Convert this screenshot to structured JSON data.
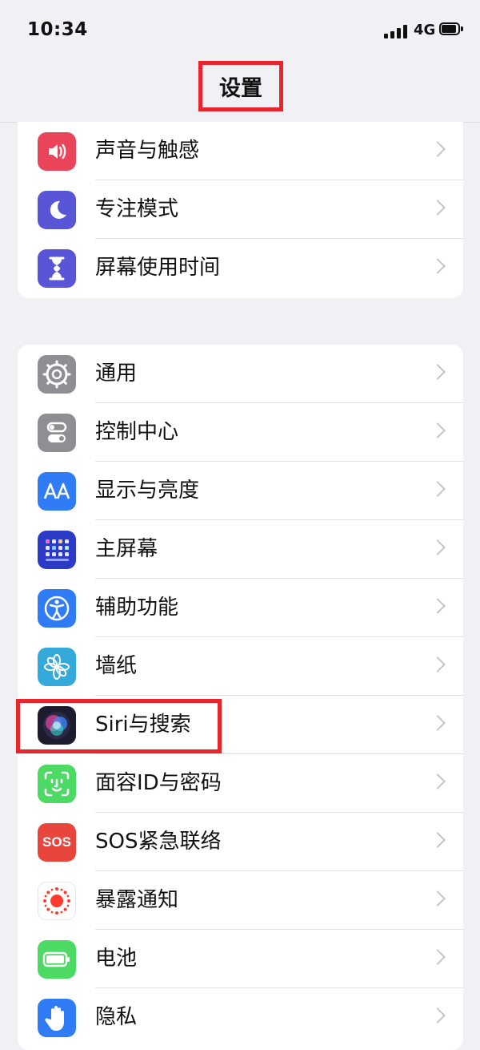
{
  "status_bar": {
    "time": "10:34",
    "network": "4G"
  },
  "nav": {
    "title": "设置"
  },
  "groups": [
    {
      "items": [
        {
          "label": "声音与触感",
          "icon": "speaker-icon",
          "color": "#e9445a"
        },
        {
          "label": "专注模式",
          "icon": "moon-icon",
          "color": "#5856d6"
        },
        {
          "label": "屏幕使用时间",
          "icon": "hourglass-icon",
          "color": "#5856d6"
        }
      ]
    },
    {
      "items": [
        {
          "label": "通用",
          "icon": "gear-icon",
          "color": "#8e8e93"
        },
        {
          "label": "控制中心",
          "icon": "toggles-icon",
          "color": "#8e8e93"
        },
        {
          "label": "显示与亮度",
          "icon": "text-size-icon",
          "color": "#2f7cf6"
        },
        {
          "label": "主屏幕",
          "icon": "home-grid-icon",
          "color": "#2b3bc6"
        },
        {
          "label": "辅助功能",
          "icon": "accessibility-icon",
          "color": "#2f7cf6"
        },
        {
          "label": "墙纸",
          "icon": "flower-icon",
          "color": "#34aadc"
        },
        {
          "label": "Siri与搜索",
          "icon": "siri-icon",
          "color": "#1c1c2e"
        },
        {
          "label": "面容ID与密码",
          "icon": "face-id-icon",
          "color": "#4cd964"
        },
        {
          "label": "SOS紧急联络",
          "icon": "sos-icon",
          "color": "#e8453c",
          "icon_text": "SOS"
        },
        {
          "label": "暴露通知",
          "icon": "exposure-icon",
          "color": "#ffffff"
        },
        {
          "label": "电池",
          "icon": "battery-icon",
          "color": "#4cd964"
        },
        {
          "label": "隐私",
          "icon": "hand-icon",
          "color": "#2f7cf6"
        }
      ]
    }
  ],
  "highlight_colors": {
    "annotation": "#e8252c"
  }
}
